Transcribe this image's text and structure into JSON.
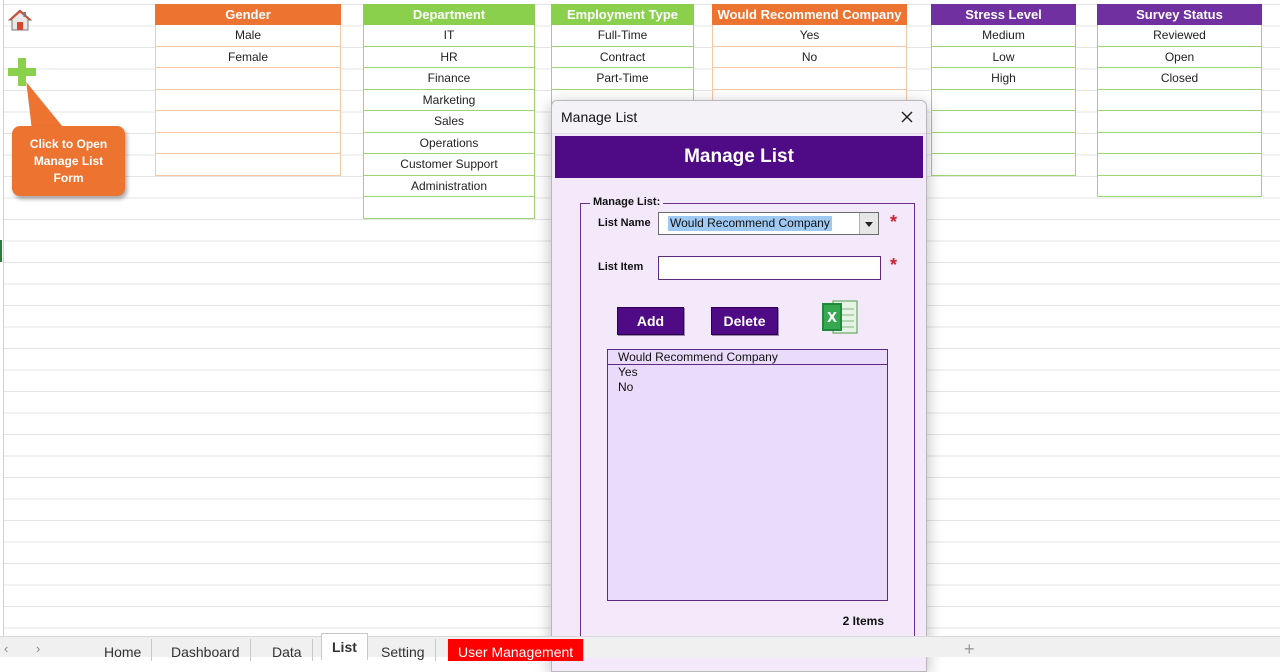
{
  "tables": [
    {
      "header": "Gender",
      "color": "#ed7331",
      "border": "#f6c6a5",
      "items": [
        "Male",
        "Female",
        "",
        "",
        "",
        "",
        ""
      ]
    },
    {
      "header": "Department",
      "color": "#8bd04d",
      "border": "#9dd66e",
      "items": [
        "IT",
        "HR",
        "Finance",
        "Marketing",
        "Sales",
        "Operations",
        "Customer Support",
        "Administration",
        ""
      ]
    },
    {
      "header": "Employment Type",
      "color": "#8bd04d",
      "border": "#9dd66e",
      "items": [
        "Full-Time",
        "Contract",
        "Part-Time",
        "",
        "",
        "",
        ""
      ]
    },
    {
      "header": "Would Recommend Company",
      "color": "#ed7331",
      "border": "#f6c6a5",
      "items": [
        "Yes",
        "No",
        "",
        "",
        "",
        "",
        ""
      ]
    },
    {
      "header": "Stress Level",
      "color": "#7030a0",
      "border": "#9dd66e",
      "items": [
        "Medium",
        "Low",
        "High",
        "",
        "",
        "",
        ""
      ]
    },
    {
      "header": "Survey Status",
      "color": "#7030a0",
      "border": "#9dd66e",
      "items": [
        "Reviewed",
        "Open",
        "Closed",
        "",
        "",
        "",
        "",
        ""
      ]
    }
  ],
  "callout": {
    "text": "Click to Open\nManage List\nForm"
  },
  "dialog": {
    "title": "Manage List",
    "banner": "Manage List",
    "group_label": "Manage List:",
    "list_name_label": "List Name",
    "list_name_value": "Would Recommend Company",
    "list_item_label": "List Item",
    "list_item_value": "",
    "required_mark": "*",
    "add_label": "Add",
    "delete_label": "Delete",
    "listbox_header": "Would Recommend Company",
    "listbox_items": [
      "Yes",
      "No"
    ],
    "count_text": "2 Items"
  },
  "tabs": [
    "Home",
    "Dashboard",
    "Data",
    "List",
    "Setting",
    "User Management"
  ],
  "active_tab": "List"
}
